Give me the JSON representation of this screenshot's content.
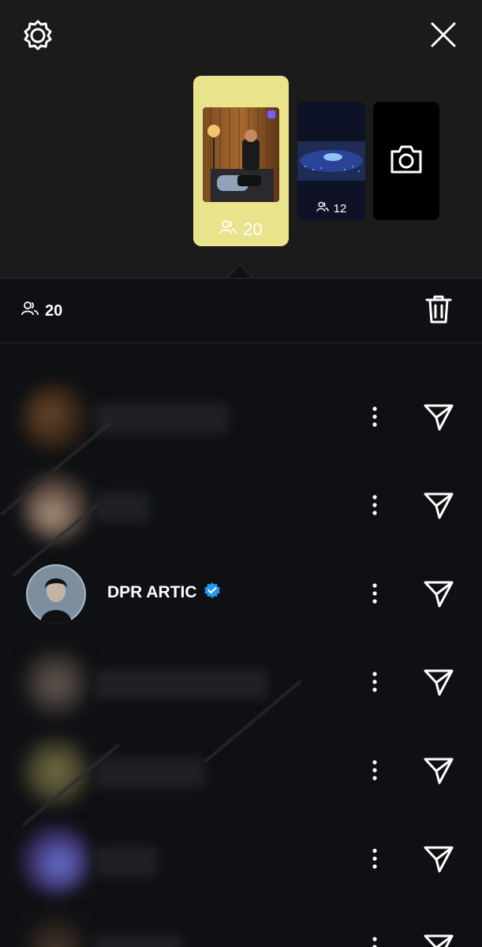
{
  "colors": {
    "top_bg": "#1b1b1c",
    "sheet_bg": "#0e1013",
    "story_yellow": "#e9e38c",
    "verified_blue": "#1f9bf0"
  },
  "header": {
    "settings_icon": "gear-icon",
    "close_icon": "close-icon"
  },
  "stories": [
    {
      "viewers": "20",
      "selected": true
    },
    {
      "viewers": "12",
      "selected": false
    }
  ],
  "camera_icon": "camera-icon",
  "sheet": {
    "viewer_count": "20",
    "delete_icon": "trash-icon"
  },
  "viewers": [
    {
      "name": "",
      "blurred": true
    },
    {
      "name": "",
      "blurred": true
    },
    {
      "name": "DPR ARTIC",
      "verified": true,
      "blurred": false
    },
    {
      "name": "",
      "blurred": true
    },
    {
      "name": "",
      "blurred": true
    },
    {
      "name": "",
      "blurred": true
    },
    {
      "name": "",
      "blurred": true
    }
  ]
}
